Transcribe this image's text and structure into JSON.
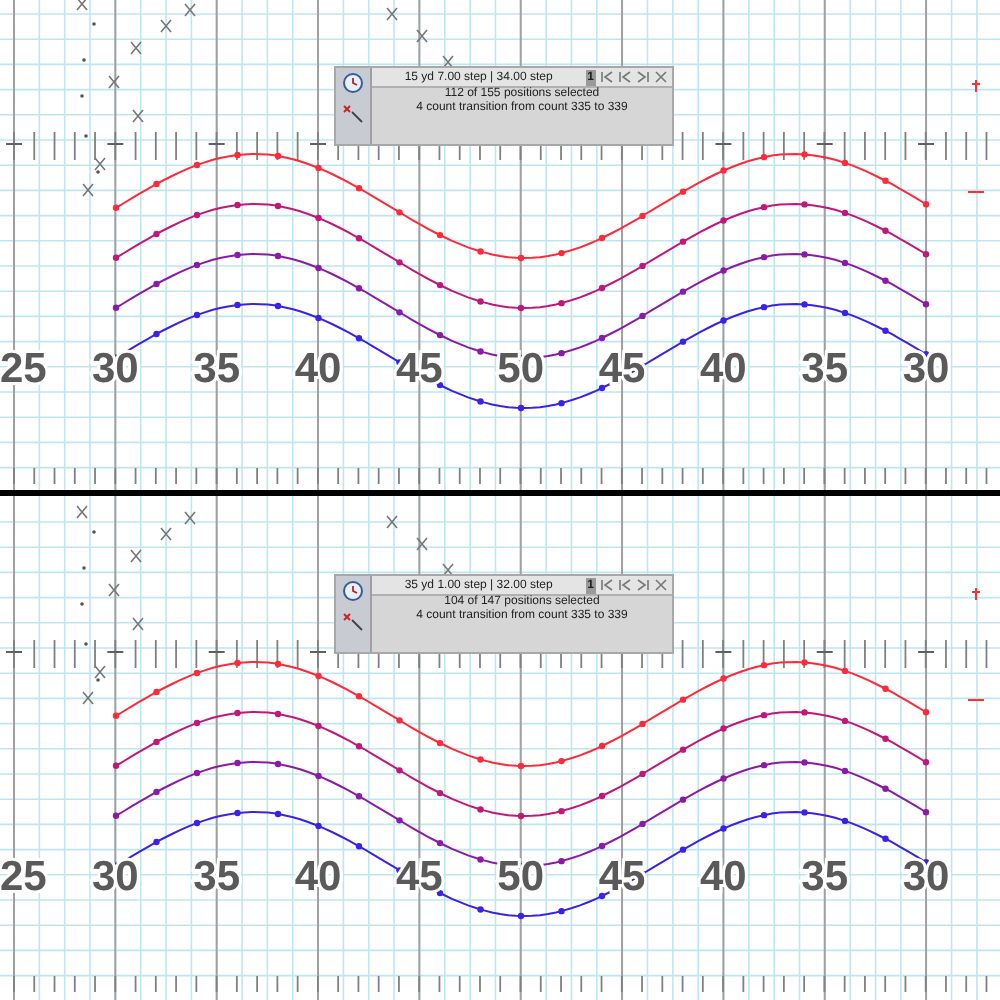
{
  "panels": [
    {
      "info": {
        "position": "15 yd 7.00 step | 34.00 step",
        "page": "1",
        "selection": "112 of 155 positions selected",
        "transition": "4 count transition from count 335 to 339"
      },
      "yard_labels": [
        "25",
        "30",
        "35",
        "40",
        "45",
        "50",
        "45",
        "40",
        "35",
        "30"
      ],
      "curves": [
        {
          "color": "#ff2a3a"
        },
        {
          "color": "#c0187a"
        },
        {
          "color": "#8a1aa8"
        },
        {
          "color": "#3a22e8"
        }
      ]
    },
    {
      "info": {
        "position": "35 yd 1.00 step | 32.00 step",
        "page": "1",
        "selection": "104 of 147 positions selected",
        "transition": "4 count transition from count 335 to 339"
      },
      "yard_labels": [
        "25",
        "30",
        "35",
        "40",
        "45",
        "50",
        "45",
        "40",
        "35",
        "30"
      ],
      "curves": [
        {
          "color": "#ff2a3a"
        },
        {
          "color": "#c0187a"
        },
        {
          "color": "#8a1aa8"
        },
        {
          "color": "#3a22e8"
        }
      ]
    }
  ]
}
